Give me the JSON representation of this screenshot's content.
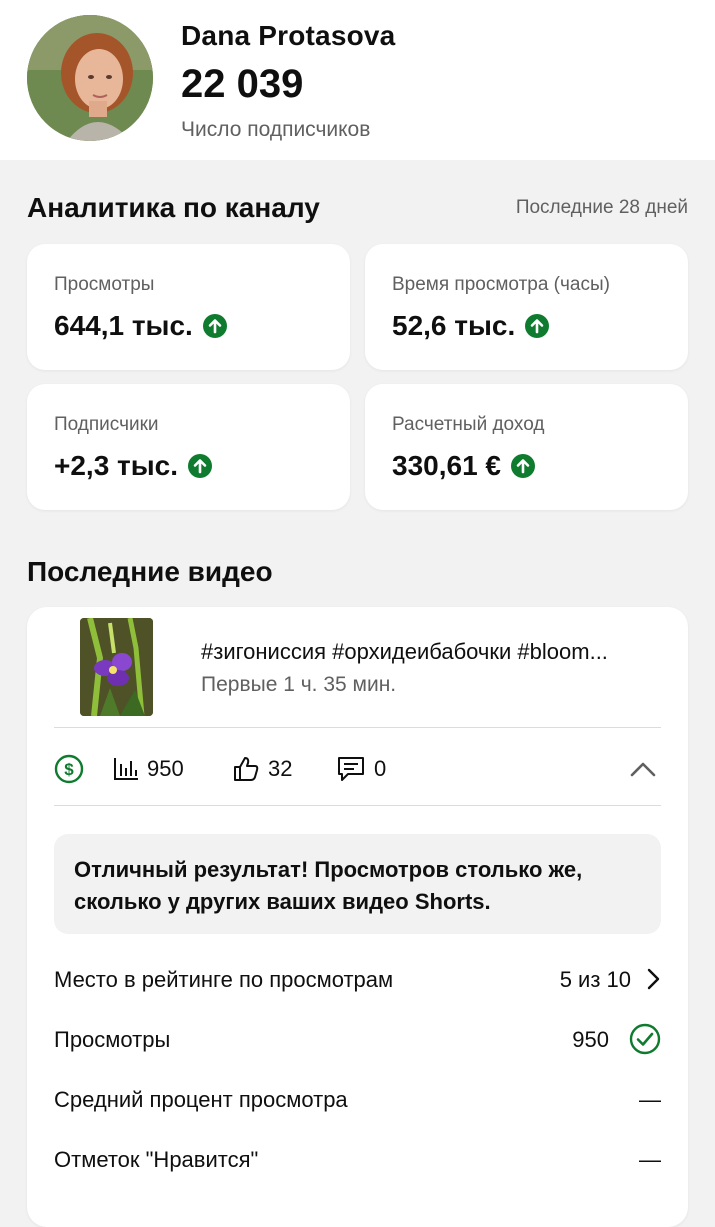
{
  "channel": {
    "name": "Dana Protasova",
    "subscriber_count": "22 039",
    "subscriber_label": "Число подписчиков"
  },
  "analytics": {
    "title": "Аналитика по каналу",
    "period": "Последние 28 дней",
    "metrics": [
      {
        "label": "Просмотры",
        "value": "644,1 тыс.",
        "trend": "up"
      },
      {
        "label": "Время просмотра (часы)",
        "value": "52,6 тыс.",
        "trend": "up"
      },
      {
        "label": "Подписчики",
        "value": "+2,3 тыс.",
        "trend": "up"
      },
      {
        "label": "Расчетный доход",
        "value": "330,61 €",
        "trend": "up"
      }
    ]
  },
  "recent_videos": {
    "title": "Последние видео",
    "video": {
      "title": "#зигониссия #орхидеибабочки #bloom...",
      "age": "Первые 1 ч. 35 мин.",
      "stats": {
        "views": "950",
        "likes": "32",
        "comments": "0"
      },
      "feedback": "Отличный результат! Просмотров столько же, сколько у других ваших видео Shorts.",
      "details": [
        {
          "label": "Место в рейтинге по просмотрам",
          "value": "5 из 10",
          "icon": "chevron-right-icon"
        },
        {
          "label": "Просмотры",
          "value": "950",
          "icon": "check-circle-icon"
        },
        {
          "label": "Средний процент просмотра",
          "value": "—"
        },
        {
          "label": "Отметок \"Нравится\"",
          "value": "—"
        }
      ]
    }
  },
  "colors": {
    "trend_up": "#0f7b2f",
    "monetization": "#0f7b2f",
    "text_primary": "#0f0f0f",
    "text_secondary": "#606060",
    "card_bg": "#ffffff",
    "page_bg": "#f2f2f2"
  }
}
